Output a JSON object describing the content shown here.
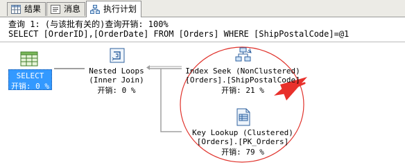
{
  "tabs": [
    {
      "label": "结果",
      "icon": "results-grid-icon",
      "active": false
    },
    {
      "label": "消息",
      "icon": "messages-icon",
      "active": false
    },
    {
      "label": "执行计划",
      "icon": "execution-plan-icon",
      "active": true
    }
  ],
  "header": {
    "query_line": "查询 1: (与该批有关的)查询开销: 100%",
    "sql_line": "SELECT [OrderID],[OrderDate] FROM [Orders] WHERE [ShipPostalCode]=@1"
  },
  "nodes": {
    "select": {
      "name": "SELECT",
      "cost": "开销: 0 %",
      "icon": "select-result-icon"
    },
    "nested_loops": {
      "name": "Nested Loops",
      "detail": "(Inner Join)",
      "cost": "开销: 0 %",
      "icon": "nested-loops-icon"
    },
    "index_seek": {
      "name": "Index Seek (NonClustered)",
      "detail": "[Orders].[ShipPostalCode]",
      "cost": "开销: 21 %",
      "icon": "index-seek-icon"
    },
    "key_lookup": {
      "name": "Key Lookup (Clustered)",
      "detail": "[Orders].[PK_Orders]",
      "cost": "开销: 79 %",
      "icon": "key-lookup-icon"
    }
  },
  "annotation": {
    "color": "#e8302b"
  }
}
